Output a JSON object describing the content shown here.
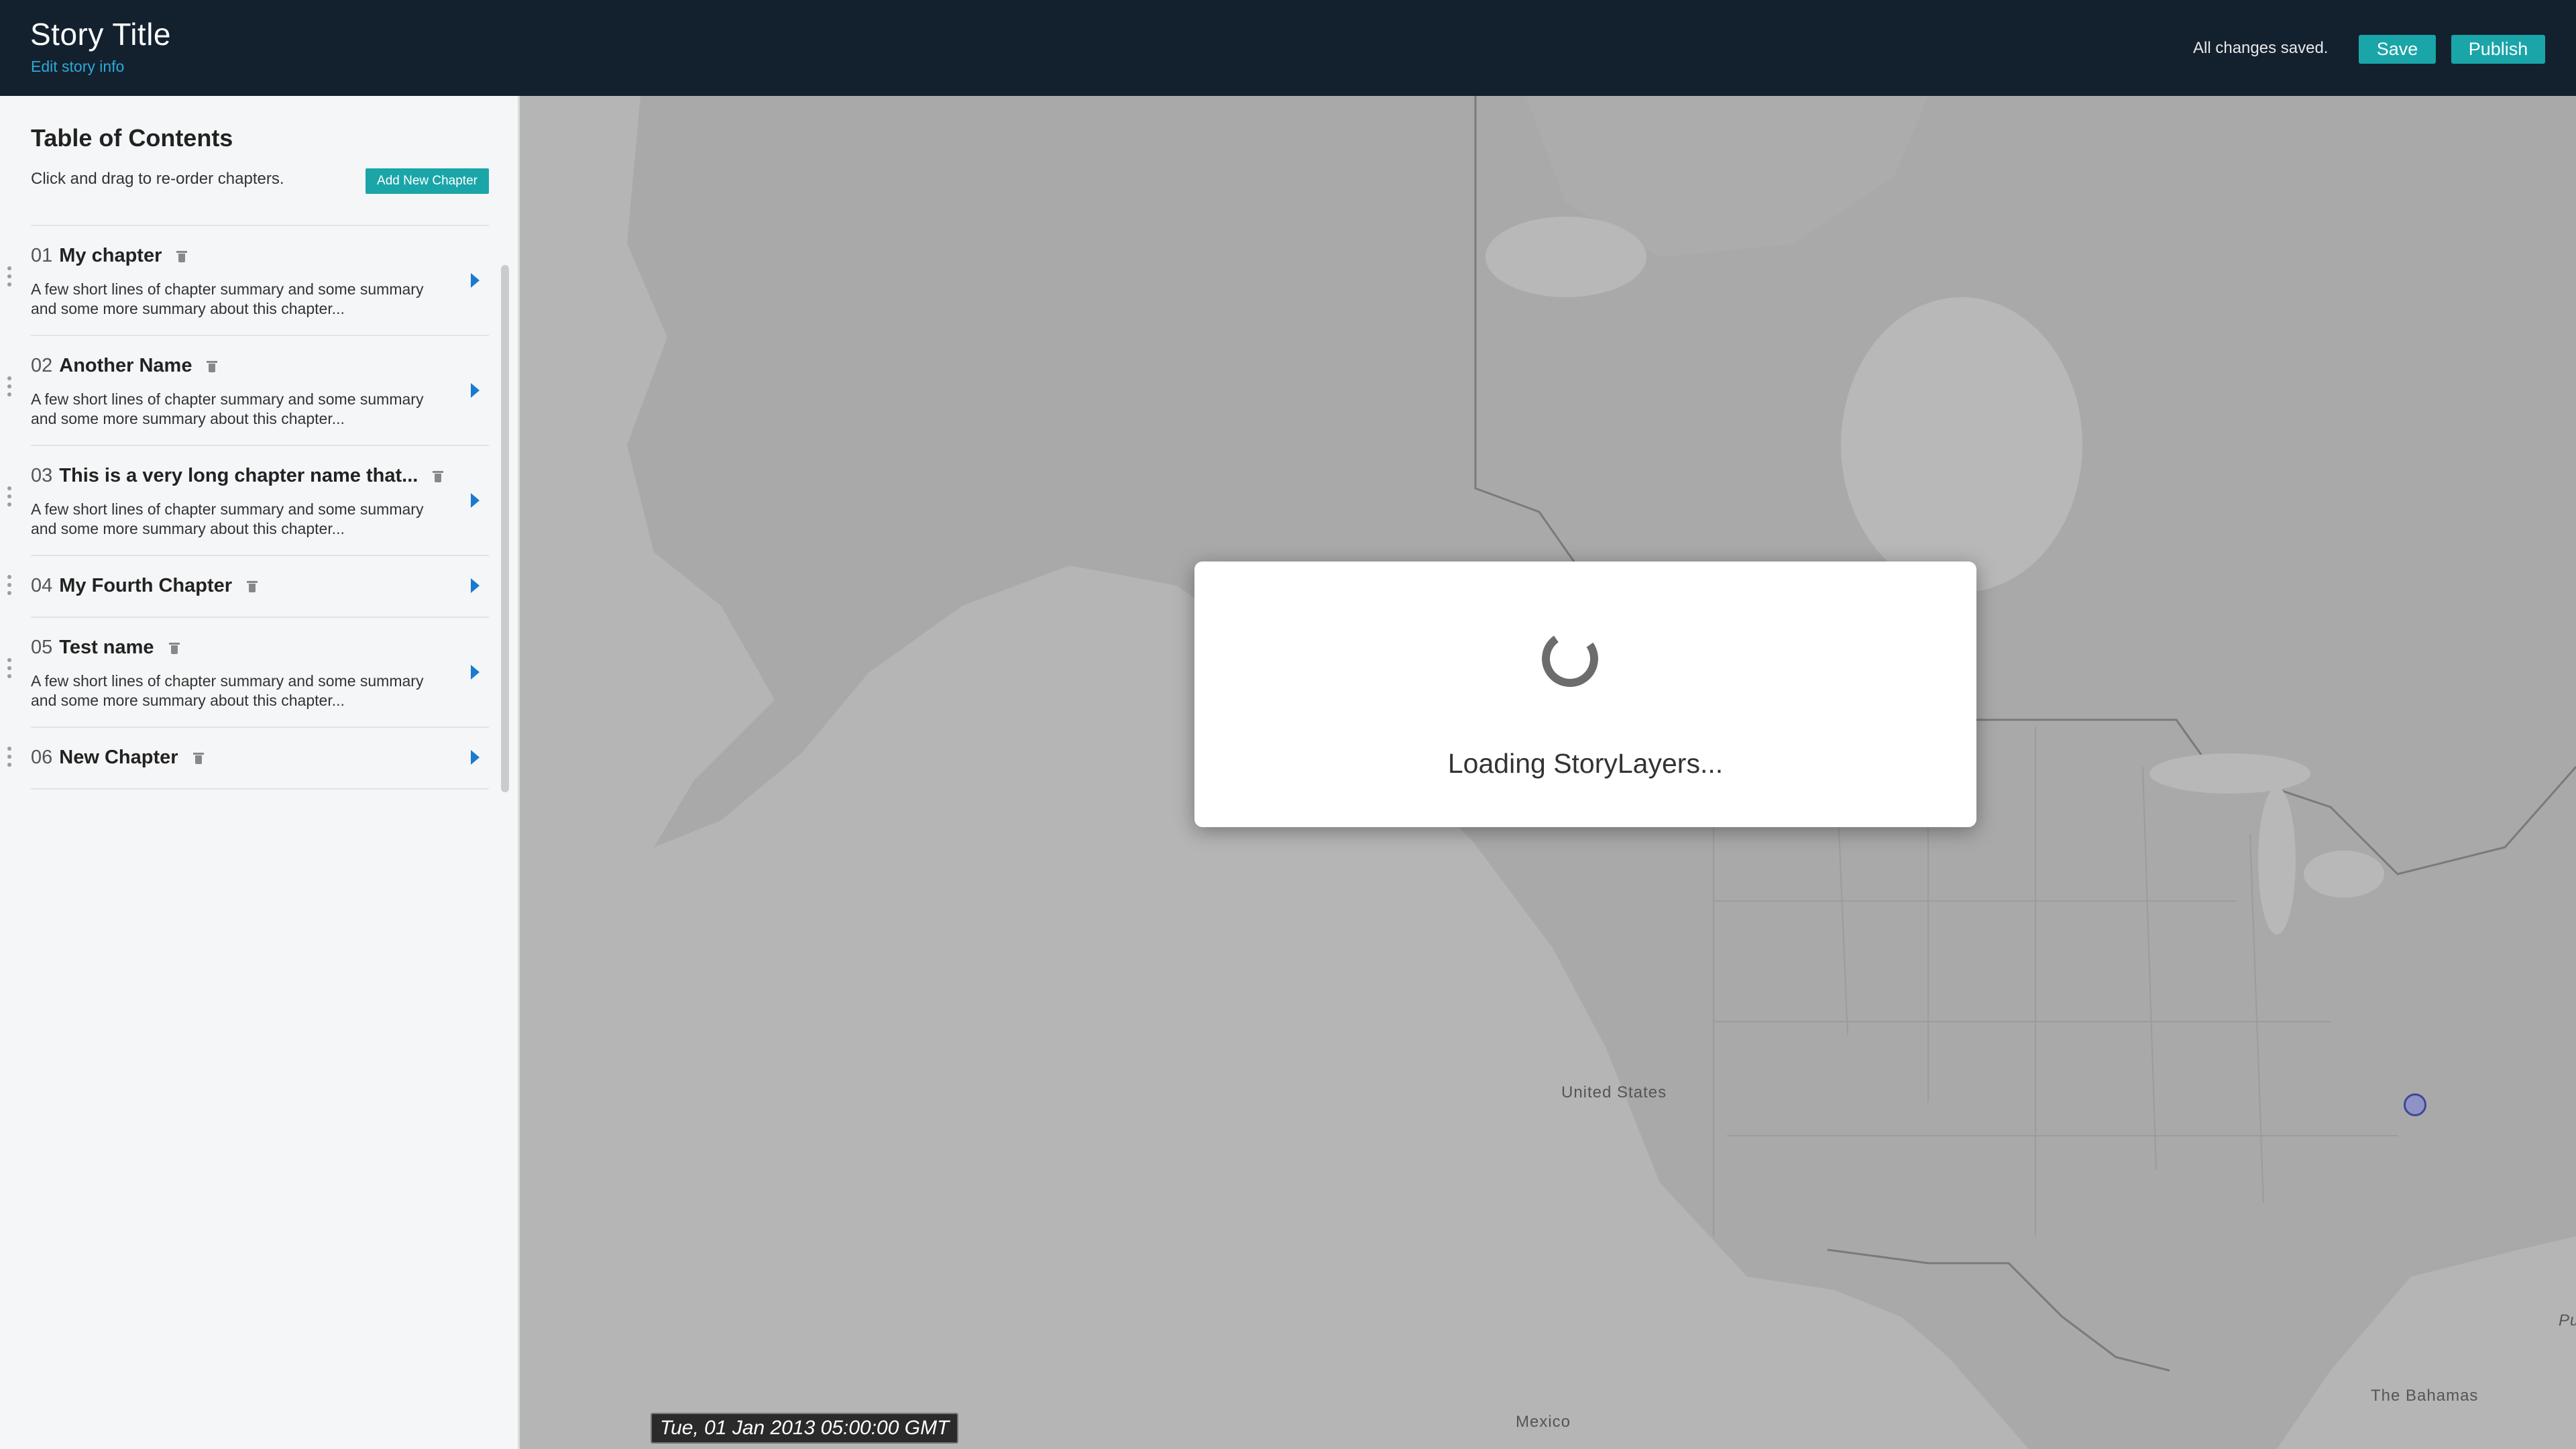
{
  "header": {
    "title": "Story Title",
    "edit_link": "Edit story info",
    "status": "All changes saved.",
    "save_label": "Save",
    "publish_label": "Publish"
  },
  "sidebar": {
    "title": "Table of Contents",
    "hint": "Click and drag to re-order chapters.",
    "add_button": "Add New Chapter",
    "chapters": [
      {
        "num": "01",
        "name": "My chapter",
        "summary": "A few short lines of chapter summary and some summary and some more summary about this chapter..."
      },
      {
        "num": "02",
        "name": "Another Name",
        "summary": "A few short lines of chapter summary and some summary and some more summary about this chapter..."
      },
      {
        "num": "03",
        "name": "This is a very long chapter name that...",
        "summary": "A few short lines of chapter summary and some summary and some more summary about this chapter..."
      },
      {
        "num": "04",
        "name": "My Fourth Chapter",
        "summary": ""
      },
      {
        "num": "05",
        "name": "Test name",
        "summary": "A few short lines of chapter summary and some summary and some more summary about this chapter..."
      },
      {
        "num": "06",
        "name": "New Chapter",
        "summary": ""
      }
    ]
  },
  "map": {
    "labels": {
      "us": "United States",
      "mexico": "Mexico",
      "bahamas": "The Bahamas",
      "edge": "Pu"
    },
    "date": "Tue, 01 Jan 2013 05:00:00 GMT"
  },
  "modal": {
    "text": "Loading StoryLayers..."
  },
  "colors": {
    "header_bg": "#13212f",
    "accent": "#1aa5a9",
    "link": "#2ea9d6",
    "arrow": "#1a7ad0"
  }
}
